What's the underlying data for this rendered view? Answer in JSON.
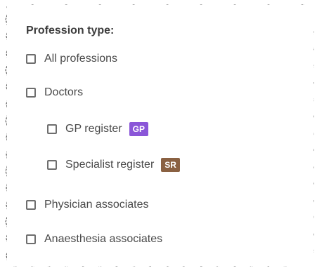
{
  "filter": {
    "title": "Profession type:",
    "options": [
      {
        "label": "All professions",
        "checked": false
      },
      {
        "label": "Doctors",
        "checked": false
      },
      {
        "label": "GP register",
        "checked": false,
        "badge": "GP",
        "badge_color": "#8a56d8"
      },
      {
        "label": "Specialist register",
        "checked": false,
        "badge": "SR",
        "badge_color": "#8a6142"
      },
      {
        "label": "Physician associates",
        "checked": false
      },
      {
        "label": "Anaesthesia associates",
        "checked": false
      }
    ]
  },
  "colors": {
    "title": "#3d3d3d",
    "label": "#4a4a4a",
    "checkbox_border": "#6e6e6e"
  }
}
